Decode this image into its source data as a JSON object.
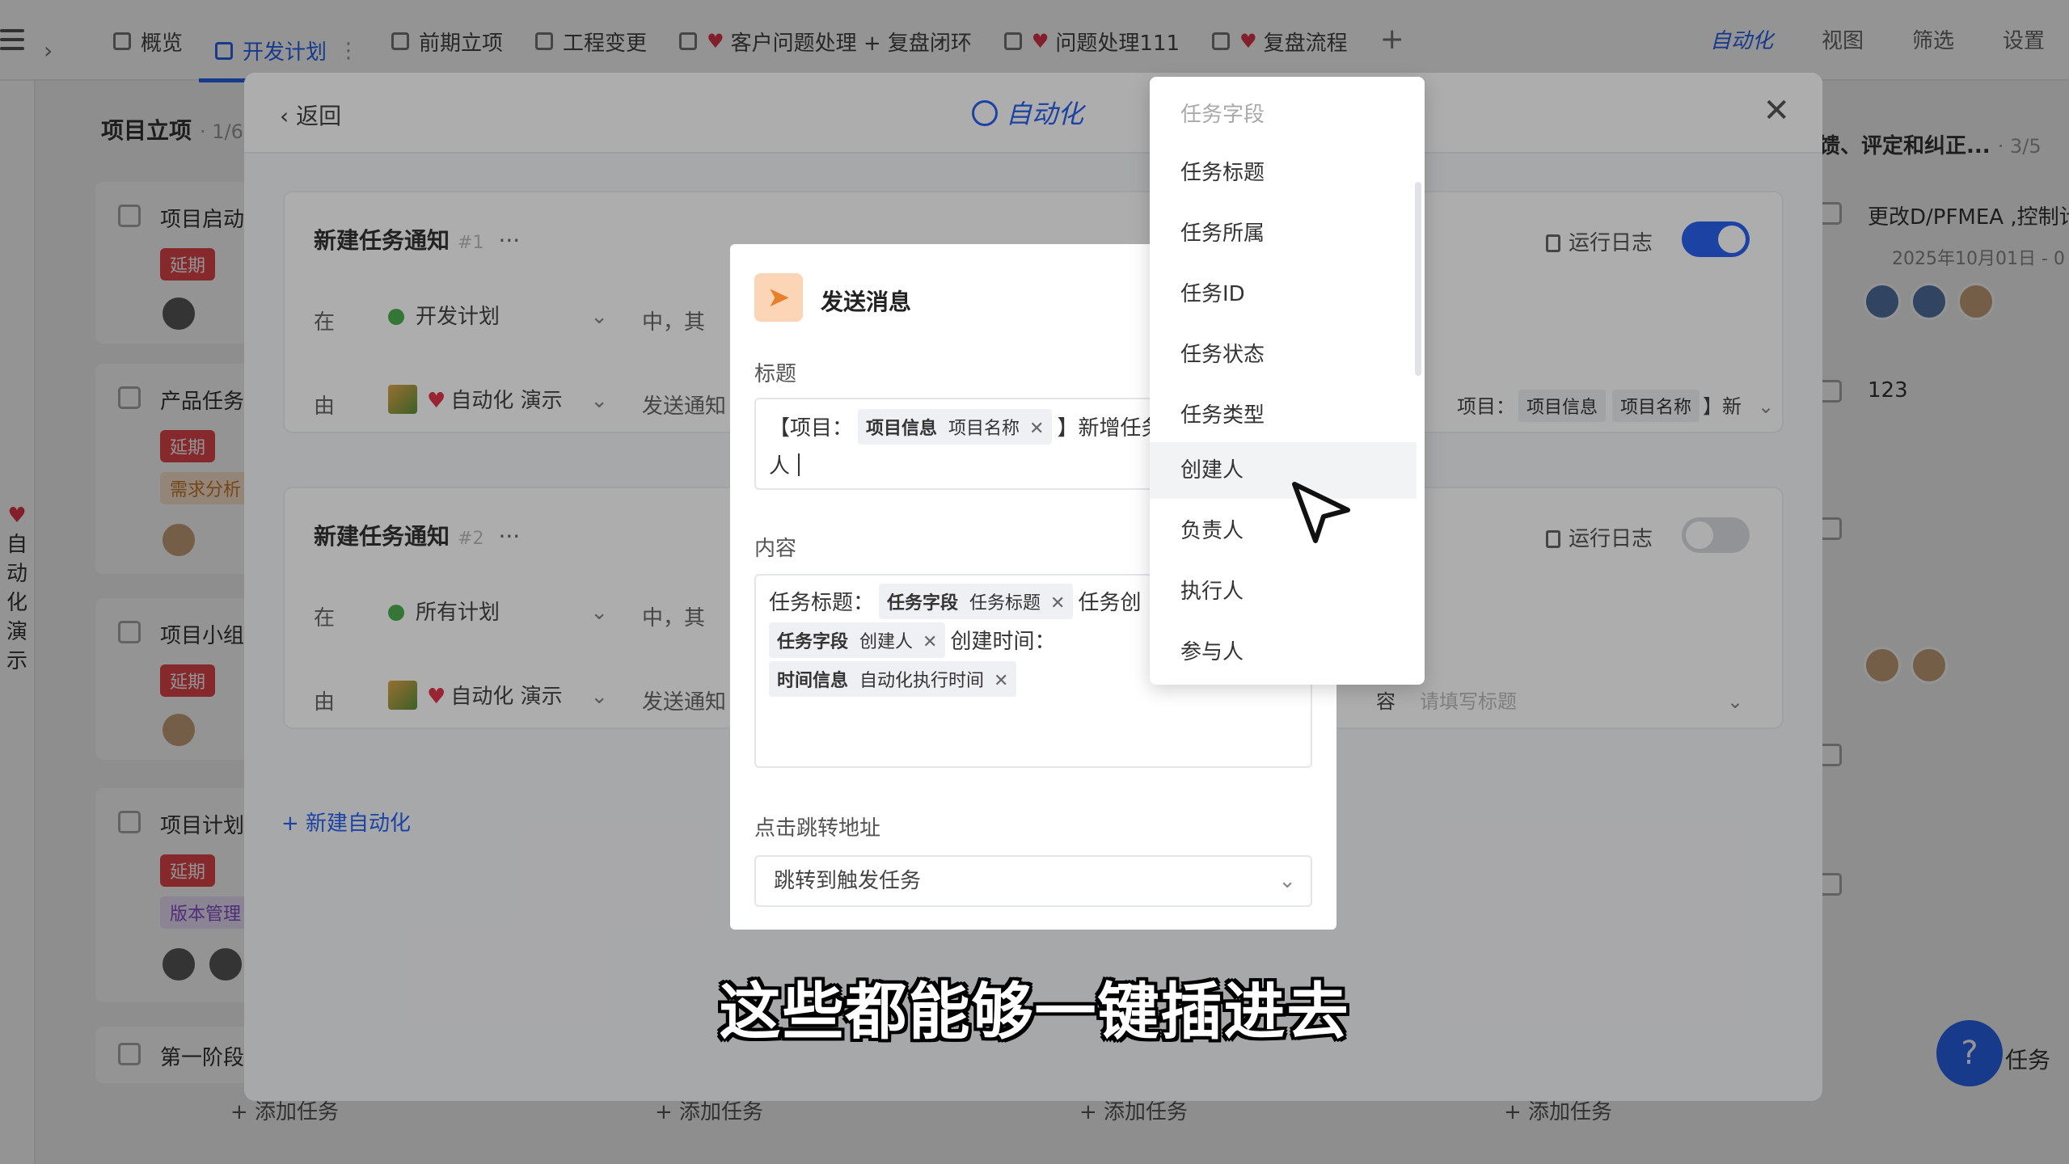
{
  "topbar": {
    "tabs": [
      {
        "label": "概览",
        "heart": false
      },
      {
        "label": "开发计划",
        "heart": false,
        "active": true
      },
      {
        "label": "前期立项",
        "heart": false
      },
      {
        "label": "工程变更",
        "heart": false
      },
      {
        "label": "客户问题处理 + 复盘闭环",
        "heart": true
      },
      {
        "label": "问题处理111",
        "heart": true
      },
      {
        "label": "复盘流程",
        "heart": true
      }
    ],
    "add_label": "+",
    "right": {
      "automation": "自动化",
      "view": "视图",
      "filter": "筛选",
      "settings": "设置"
    }
  },
  "rail": {
    "vertical_text": [
      "自",
      "动",
      "化",
      "演",
      "示"
    ]
  },
  "board": {
    "left_column": {
      "title": "项目立项",
      "count": "· 1/6",
      "cards": [
        {
          "label": "项目启动",
          "badge": "延期"
        },
        {
          "label": "产品任务",
          "badge": "延期",
          "tag": "需求分析"
        },
        {
          "label": "项目小组",
          "badge": "延期"
        },
        {
          "label": "项目计划",
          "badge": "延期",
          "tag": "版本管理"
        },
        {
          "label": "第一阶段"
        }
      ]
    },
    "right_column": {
      "title": "馈、评定和纠正...",
      "count": "· 3/5",
      "items": [
        {
          "label": "更改D/PFMEA ,控制计",
          "date": "2025年10月01日 - 0"
        },
        {
          "label": "123"
        }
      ]
    },
    "add_task": "+ 添加任务",
    "fab_label": "任务"
  },
  "automation_modal": {
    "back": "返回",
    "title": "自动化",
    "close": "✕",
    "rules": [
      {
        "name": "新建任务通知",
        "index": "#1",
        "more": "···",
        "run_log": "运行日志",
        "enabled": true,
        "in_label": "在",
        "scope": "开发计划",
        "mid_text": "中，其",
        "by_label": "由",
        "actor": "自动化 演示",
        "action": "发送通知",
        "right_prefix": "项目：",
        "right_chip1": "项目信息",
        "right_chip2": "项目名称",
        "right_suffix": "】新"
      },
      {
        "name": "新建任务通知",
        "index": "#2",
        "more": "···",
        "run_log": "运行日志",
        "enabled": false,
        "in_label": "在",
        "scope": "所有计划",
        "mid_text": "中，其",
        "by_label": "由",
        "actor": "自动化 演示",
        "action": "发送通知",
        "right_prefix": "容",
        "right_placeholder": "请填写标题"
      }
    ],
    "new_automation": "+ 新建自动化"
  },
  "send_dialog": {
    "title": "发送消息",
    "title_label": "标题",
    "title_line1_prefix": "【项目：",
    "title_chip_group": "项目信息",
    "title_chip_value": "项目名称",
    "title_line1_suffix": "】新增任务",
    "title_line2": "人",
    "content_label": "内容",
    "content_l1_text": "任务标题：",
    "content_l1_chip_group": "任务字段",
    "content_l1_chip_value": "任务标题",
    "content_l1_suffix": "任务创",
    "content_l2_chip_group": "任务字段",
    "content_l2_chip_value": "创建人",
    "content_l2_suffix": "创建时间：",
    "content_l3_chip_group": "时间信息",
    "content_l3_chip_value": "自动化执行时间",
    "link_label": "点击跳转地址",
    "link_value": "跳转到触发任务"
  },
  "dropdown": {
    "header": "任务字段",
    "items": [
      "任务标题",
      "任务所属",
      "任务ID",
      "任务状态",
      "任务类型",
      "创建人",
      "负责人",
      "执行人",
      "参与人"
    ],
    "hovered": "创建人"
  },
  "subtitle": "这些都能够一键插进去",
  "colors": {
    "accent": "#2a64f0",
    "danger": "#e5484d",
    "heart": "#e2364a",
    "send_icon_bg": "#fbd5b5"
  }
}
